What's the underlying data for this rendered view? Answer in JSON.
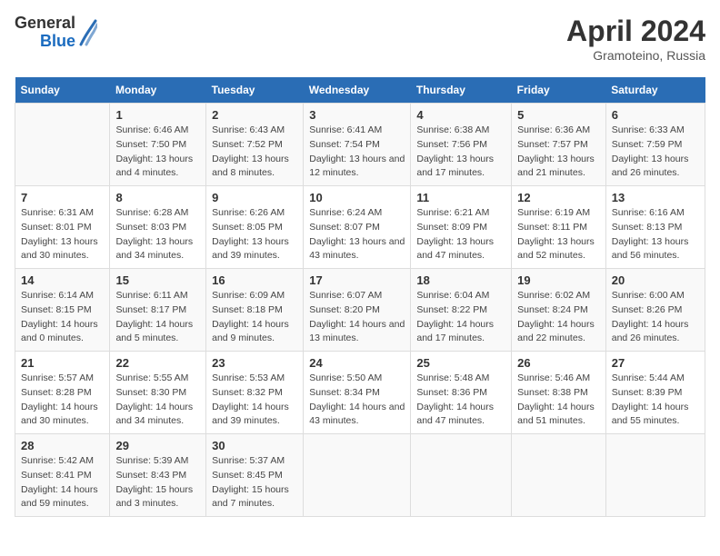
{
  "header": {
    "logo_general": "General",
    "logo_blue": "Blue",
    "title": "April 2024",
    "subtitle": "Gramoteino, Russia"
  },
  "weekdays": [
    "Sunday",
    "Monday",
    "Tuesday",
    "Wednesday",
    "Thursday",
    "Friday",
    "Saturday"
  ],
  "weeks": [
    [
      {
        "day": "",
        "sunrise": "",
        "sunset": "",
        "daylight": ""
      },
      {
        "day": "1",
        "sunrise": "Sunrise: 6:46 AM",
        "sunset": "Sunset: 7:50 PM",
        "daylight": "Daylight: 13 hours and 4 minutes."
      },
      {
        "day": "2",
        "sunrise": "Sunrise: 6:43 AM",
        "sunset": "Sunset: 7:52 PM",
        "daylight": "Daylight: 13 hours and 8 minutes."
      },
      {
        "day": "3",
        "sunrise": "Sunrise: 6:41 AM",
        "sunset": "Sunset: 7:54 PM",
        "daylight": "Daylight: 13 hours and 12 minutes."
      },
      {
        "day": "4",
        "sunrise": "Sunrise: 6:38 AM",
        "sunset": "Sunset: 7:56 PM",
        "daylight": "Daylight: 13 hours and 17 minutes."
      },
      {
        "day": "5",
        "sunrise": "Sunrise: 6:36 AM",
        "sunset": "Sunset: 7:57 PM",
        "daylight": "Daylight: 13 hours and 21 minutes."
      },
      {
        "day": "6",
        "sunrise": "Sunrise: 6:33 AM",
        "sunset": "Sunset: 7:59 PM",
        "daylight": "Daylight: 13 hours and 26 minutes."
      }
    ],
    [
      {
        "day": "7",
        "sunrise": "Sunrise: 6:31 AM",
        "sunset": "Sunset: 8:01 PM",
        "daylight": "Daylight: 13 hours and 30 minutes."
      },
      {
        "day": "8",
        "sunrise": "Sunrise: 6:28 AM",
        "sunset": "Sunset: 8:03 PM",
        "daylight": "Daylight: 13 hours and 34 minutes."
      },
      {
        "day": "9",
        "sunrise": "Sunrise: 6:26 AM",
        "sunset": "Sunset: 8:05 PM",
        "daylight": "Daylight: 13 hours and 39 minutes."
      },
      {
        "day": "10",
        "sunrise": "Sunrise: 6:24 AM",
        "sunset": "Sunset: 8:07 PM",
        "daylight": "Daylight: 13 hours and 43 minutes."
      },
      {
        "day": "11",
        "sunrise": "Sunrise: 6:21 AM",
        "sunset": "Sunset: 8:09 PM",
        "daylight": "Daylight: 13 hours and 47 minutes."
      },
      {
        "day": "12",
        "sunrise": "Sunrise: 6:19 AM",
        "sunset": "Sunset: 8:11 PM",
        "daylight": "Daylight: 13 hours and 52 minutes."
      },
      {
        "day": "13",
        "sunrise": "Sunrise: 6:16 AM",
        "sunset": "Sunset: 8:13 PM",
        "daylight": "Daylight: 13 hours and 56 minutes."
      }
    ],
    [
      {
        "day": "14",
        "sunrise": "Sunrise: 6:14 AM",
        "sunset": "Sunset: 8:15 PM",
        "daylight": "Daylight: 14 hours and 0 minutes."
      },
      {
        "day": "15",
        "sunrise": "Sunrise: 6:11 AM",
        "sunset": "Sunset: 8:17 PM",
        "daylight": "Daylight: 14 hours and 5 minutes."
      },
      {
        "day": "16",
        "sunrise": "Sunrise: 6:09 AM",
        "sunset": "Sunset: 8:18 PM",
        "daylight": "Daylight: 14 hours and 9 minutes."
      },
      {
        "day": "17",
        "sunrise": "Sunrise: 6:07 AM",
        "sunset": "Sunset: 8:20 PM",
        "daylight": "Daylight: 14 hours and 13 minutes."
      },
      {
        "day": "18",
        "sunrise": "Sunrise: 6:04 AM",
        "sunset": "Sunset: 8:22 PM",
        "daylight": "Daylight: 14 hours and 17 minutes."
      },
      {
        "day": "19",
        "sunrise": "Sunrise: 6:02 AM",
        "sunset": "Sunset: 8:24 PM",
        "daylight": "Daylight: 14 hours and 22 minutes."
      },
      {
        "day": "20",
        "sunrise": "Sunrise: 6:00 AM",
        "sunset": "Sunset: 8:26 PM",
        "daylight": "Daylight: 14 hours and 26 minutes."
      }
    ],
    [
      {
        "day": "21",
        "sunrise": "Sunrise: 5:57 AM",
        "sunset": "Sunset: 8:28 PM",
        "daylight": "Daylight: 14 hours and 30 minutes."
      },
      {
        "day": "22",
        "sunrise": "Sunrise: 5:55 AM",
        "sunset": "Sunset: 8:30 PM",
        "daylight": "Daylight: 14 hours and 34 minutes."
      },
      {
        "day": "23",
        "sunrise": "Sunrise: 5:53 AM",
        "sunset": "Sunset: 8:32 PM",
        "daylight": "Daylight: 14 hours and 39 minutes."
      },
      {
        "day": "24",
        "sunrise": "Sunrise: 5:50 AM",
        "sunset": "Sunset: 8:34 PM",
        "daylight": "Daylight: 14 hours and 43 minutes."
      },
      {
        "day": "25",
        "sunrise": "Sunrise: 5:48 AM",
        "sunset": "Sunset: 8:36 PM",
        "daylight": "Daylight: 14 hours and 47 minutes."
      },
      {
        "day": "26",
        "sunrise": "Sunrise: 5:46 AM",
        "sunset": "Sunset: 8:38 PM",
        "daylight": "Daylight: 14 hours and 51 minutes."
      },
      {
        "day": "27",
        "sunrise": "Sunrise: 5:44 AM",
        "sunset": "Sunset: 8:39 PM",
        "daylight": "Daylight: 14 hours and 55 minutes."
      }
    ],
    [
      {
        "day": "28",
        "sunrise": "Sunrise: 5:42 AM",
        "sunset": "Sunset: 8:41 PM",
        "daylight": "Daylight: 14 hours and 59 minutes."
      },
      {
        "day": "29",
        "sunrise": "Sunrise: 5:39 AM",
        "sunset": "Sunset: 8:43 PM",
        "daylight": "Daylight: 15 hours and 3 minutes."
      },
      {
        "day": "30",
        "sunrise": "Sunrise: 5:37 AM",
        "sunset": "Sunset: 8:45 PM",
        "daylight": "Daylight: 15 hours and 7 minutes."
      },
      {
        "day": "",
        "sunrise": "",
        "sunset": "",
        "daylight": ""
      },
      {
        "day": "",
        "sunrise": "",
        "sunset": "",
        "daylight": ""
      },
      {
        "day": "",
        "sunrise": "",
        "sunset": "",
        "daylight": ""
      },
      {
        "day": "",
        "sunrise": "",
        "sunset": "",
        "daylight": ""
      }
    ]
  ]
}
